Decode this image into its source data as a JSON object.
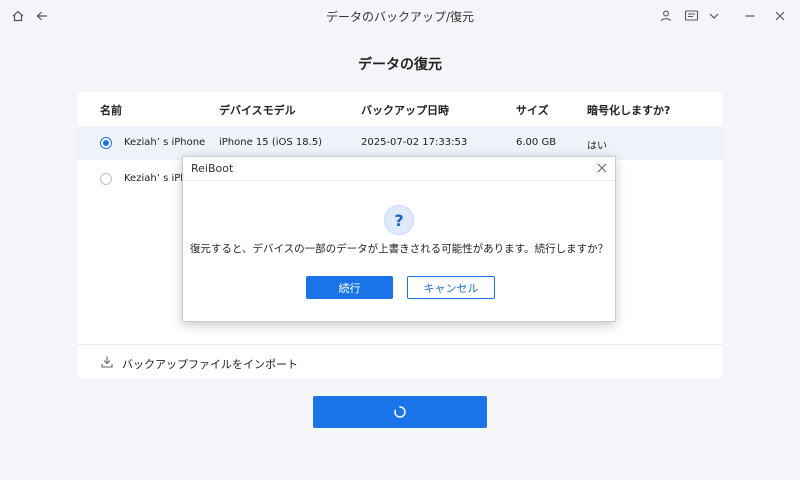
{
  "window": {
    "title": "データのバックアップ/復元",
    "icons": [
      "home-icon",
      "back-arrow-icon",
      "user-icon",
      "feedback-icon",
      "chevron-down-icon",
      "minimize-icon",
      "close-icon"
    ]
  },
  "page": {
    "title": "データの復元"
  },
  "table": {
    "headers": [
      "名前",
      "デバイスモデル",
      "バックアップ日時",
      "サイズ",
      "暗号化しますか?"
    ],
    "rows": [
      {
        "selected": true,
        "name": "Keziah’ s iPhone",
        "model": "iPhone 15 (iOS 18.5)",
        "date": "2025-07-02 17:33:53",
        "size": "6.00 GB",
        "encrypted": "はい"
      },
      {
        "selected": false,
        "name": "Keziah’ s iPh"
      }
    ]
  },
  "import": {
    "label": "バックアップファイルをインポート",
    "icon": "import-icon"
  },
  "main_button": {
    "icon": "loading-spinner-icon"
  },
  "dialog": {
    "title": "ReiBoot",
    "icon": "question-icon",
    "icon_glyph": "?",
    "message": "復元すると、デバイスの一部のデータが上書きされる可能性があります。続行しますか？",
    "confirm_label": "続行",
    "cancel_label": "キャンセル"
  },
  "colors": {
    "accent": "#1a73e8",
    "background": "#f3f5f8",
    "card": "#ffffff",
    "selected_row": "#eef2f9"
  }
}
